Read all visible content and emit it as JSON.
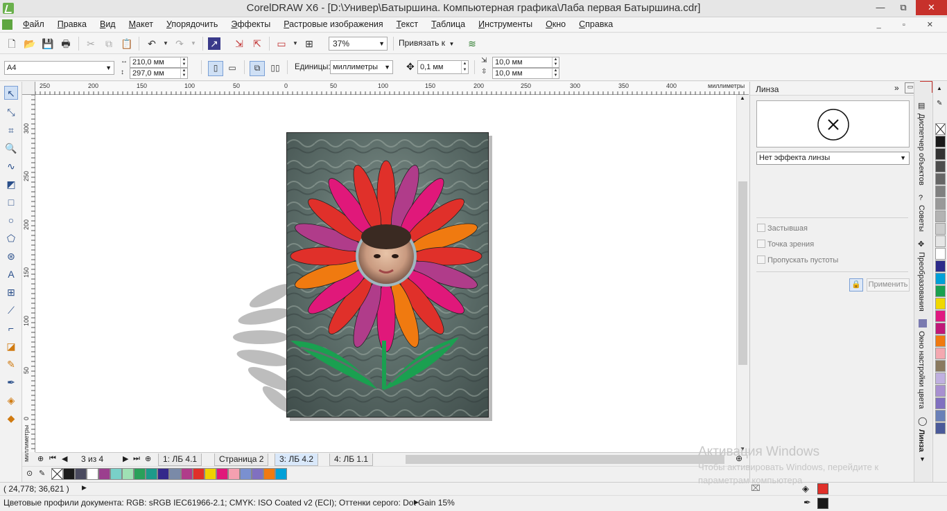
{
  "window": {
    "title": "CorelDRAW X6 - [D:\\Универ\\Батыршина. Компьютерная графика\\Лаба первая Батыршина.cdr]"
  },
  "menu": [
    "Файл",
    "Правка",
    "Вид",
    "Макет",
    "Упорядочить",
    "Эффекты",
    "Растровые изображения",
    "Текст",
    "Таблица",
    "Инструменты",
    "Окно",
    "Справка"
  ],
  "toolbar": {
    "zoom": "37%",
    "snap_label": "Привязать к"
  },
  "property_bar": {
    "page_size": "A4",
    "width": "210,0 мм",
    "height": "297,0 мм",
    "units_label": "Единицы:",
    "units_value": "миллиметры",
    "nudge": "0,1 мм",
    "dup_x": "10,0 мм",
    "dup_y": "10,0 мм"
  },
  "rulers": {
    "top_ticks": [
      "250",
      "200",
      "150",
      "100",
      "50",
      "0",
      "50",
      "100",
      "150",
      "200",
      "250",
      "300",
      "350",
      "400"
    ],
    "top_unit": "миллиметры",
    "left_ticks": [
      "300",
      "250",
      "200",
      "150",
      "100",
      "50",
      "0"
    ],
    "left_unit": "миллиметры"
  },
  "page_nav": {
    "counter": "3 из 4",
    "tabs": [
      "1: ЛБ 4.1",
      "Страница 2",
      "3: ЛБ 4.2",
      "4: ЛБ 1.1"
    ],
    "active_tab": 2
  },
  "palette": [
    "#1a1a1a",
    "#4a4a5e",
    "#ffffff",
    "#9b3f8e",
    "#79d0c8",
    "#9fe0b4",
    "#2aa05a",
    "#1c9a8a",
    "#34288a",
    "#7a8aa8",
    "#b03c8a",
    "#e0302a",
    "#f0d000",
    "#e0187a",
    "#f4a0b0",
    "#7a90d0",
    "#8070c0",
    "#f07a10",
    "#00a0d8"
  ],
  "right_palette": [
    "#1a1a1a",
    "#333333",
    "#4d4d4d",
    "#666666",
    "#808080",
    "#999999",
    "#b3b3b3",
    "#cccccc",
    "#e6e6e6",
    "#ffffff",
    "#2c2a8a",
    "#00a0d8",
    "#1aa050",
    "#f0d800",
    "#e01880",
    "#c01878",
    "#f07a10",
    "#f4a8b0",
    "#8a7a60",
    "#c0b0e0",
    "#a890d0",
    "#8070c0",
    "#6a80b8",
    "#4a5a9a"
  ],
  "status": {
    "coords": "( 24,778; 36,621 )",
    "color_profiles": "Цветовые профили документа: RGB: sRGB IEC61966-2.1; CMYK: ISO Coated v2 (ECI); Оттенки серого: Dot Gain 15%"
  },
  "docker": {
    "title": "Линза",
    "lens_type": "Нет эффекта линзы",
    "options": [
      "Застывшая",
      "Точка зрения",
      "Пропускать пустоты"
    ],
    "apply": "Применить"
  },
  "docker_tabs": [
    "Диспетчер объектов",
    "Советы",
    "Преобразования",
    "Окно настройки цвета",
    "Линза"
  ],
  "watermark": {
    "title": "Активация Windows",
    "line1": "Чтобы активировать Windows, перейдите к",
    "line2": "параметрам компьютера"
  },
  "colors": {
    "fill_indicator": "#e0302a",
    "outline_indicator": "#1a1a1a",
    "accent": "#5fa641"
  }
}
